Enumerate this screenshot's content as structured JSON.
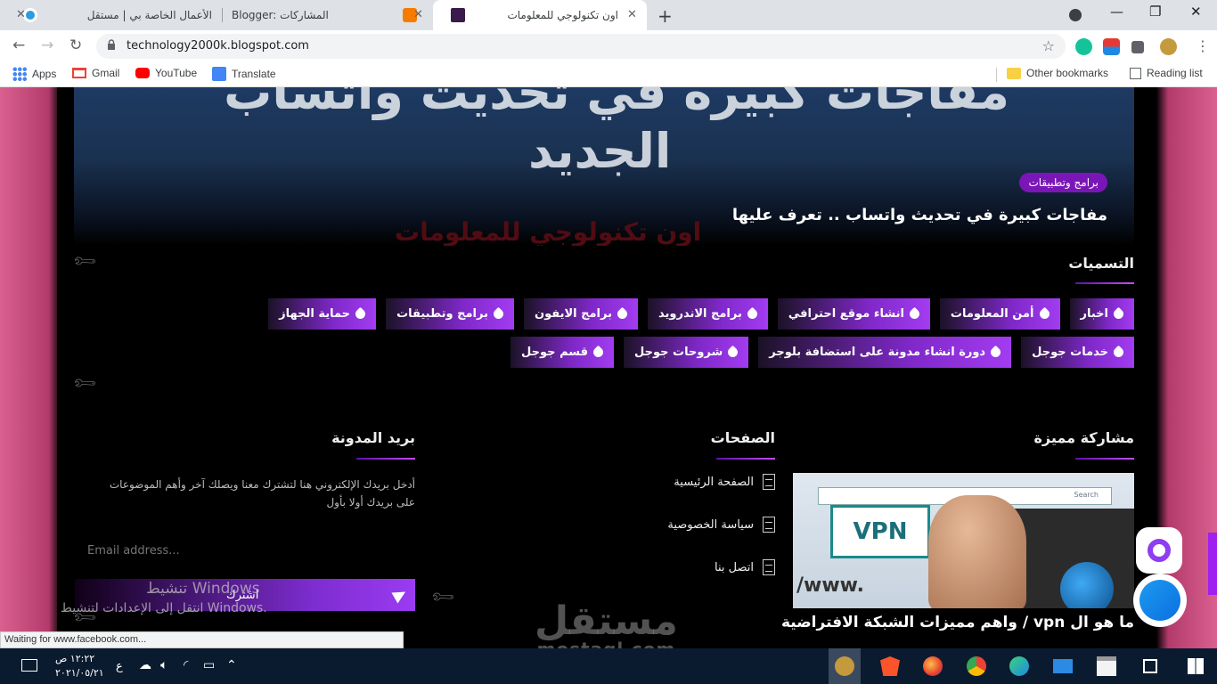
{
  "browser": {
    "tabs": [
      {
        "title": "الأعمال الخاصة بي | مستقل",
        "favicon_color": "#2d9cdb"
      },
      {
        "title": "Blogger: المشاركات",
        "favicon_color": "#f57c00"
      },
      {
        "title": "اون تكنولوجي للمعلومات",
        "favicon_color": "#3a1a4a"
      }
    ],
    "new_tab": "+",
    "url": "technology2000k.blogspot.com",
    "bookmarks": [
      {
        "label": "Apps",
        "icon": "apps-grid-icon"
      },
      {
        "label": "Gmail",
        "icon": "gmail-icon"
      },
      {
        "label": "YouTube",
        "icon": "youtube-icon"
      },
      {
        "label": "Translate",
        "icon": "translate-icon"
      }
    ],
    "other_bookmarks": "Other bookmarks",
    "reading_list": "Reading list"
  },
  "hero": {
    "bg_text_line1": "مفاجآت كبيرة في تحديث واتساب",
    "bg_text_line2": "الجديد",
    "watermark": "اون تكنولوجي للمعلومات",
    "badge": "برامج وتطبيقات",
    "title": "مفاجات كبيرة في تحديث واتساب .. تعرف عليها"
  },
  "labels_section": {
    "title": "التسميات",
    "labels": [
      "اخبار",
      "أمن المعلومات",
      "انشاء موقع احترافي",
      "برامج الاندرويد",
      "برامج الايفون",
      "برامج وتطبيقات",
      "حماية الجهاز",
      "خدمات جوجل",
      "دورة انشاء مدونة على استضافة بلوجر",
      "شروحات جوجل",
      "قسم جوجل"
    ]
  },
  "featured": {
    "title": "مشاركة مميزة",
    "image_text_vpn": "VPN",
    "image_text_www": "/www.",
    "image_search": "Search",
    "post_title": "ما هو ال vpn / واهم مميزات الشبكة الافتراضية"
  },
  "pages_section": {
    "title": "الصفحات",
    "items": [
      "الصفحة الرئيسية",
      "سياسة الخصوصية",
      "اتصل بنا"
    ]
  },
  "newsletter": {
    "title": "بريد المدونة",
    "text": "أدخل بريدك الإلكتروني هنا لتشترك معنا ويصلك آخر وأهم الموضوعات على بريدك أولا بأول",
    "placeholder": "Email address...",
    "button": "اشترك"
  },
  "windows_activation": {
    "line1": "تنشيط Windows",
    "line2": "انتقل إلى الإعدادات لتنشيط Windows."
  },
  "status_bar": "Waiting for www.facebook.com...",
  "watermark": {
    "arabic": "مستقل",
    "latin": "mostaql.com"
  },
  "taskbar": {
    "time": "١٢:٢٢ ص",
    "date": "٢٠٢١/٠٥/٢١",
    "lang": "ع"
  },
  "colors": {
    "accent": "#9b3bf2",
    "accent_dark": "#5b13a8",
    "page_side": "#d9608f",
    "taskbar": "#0b1b2f"
  }
}
